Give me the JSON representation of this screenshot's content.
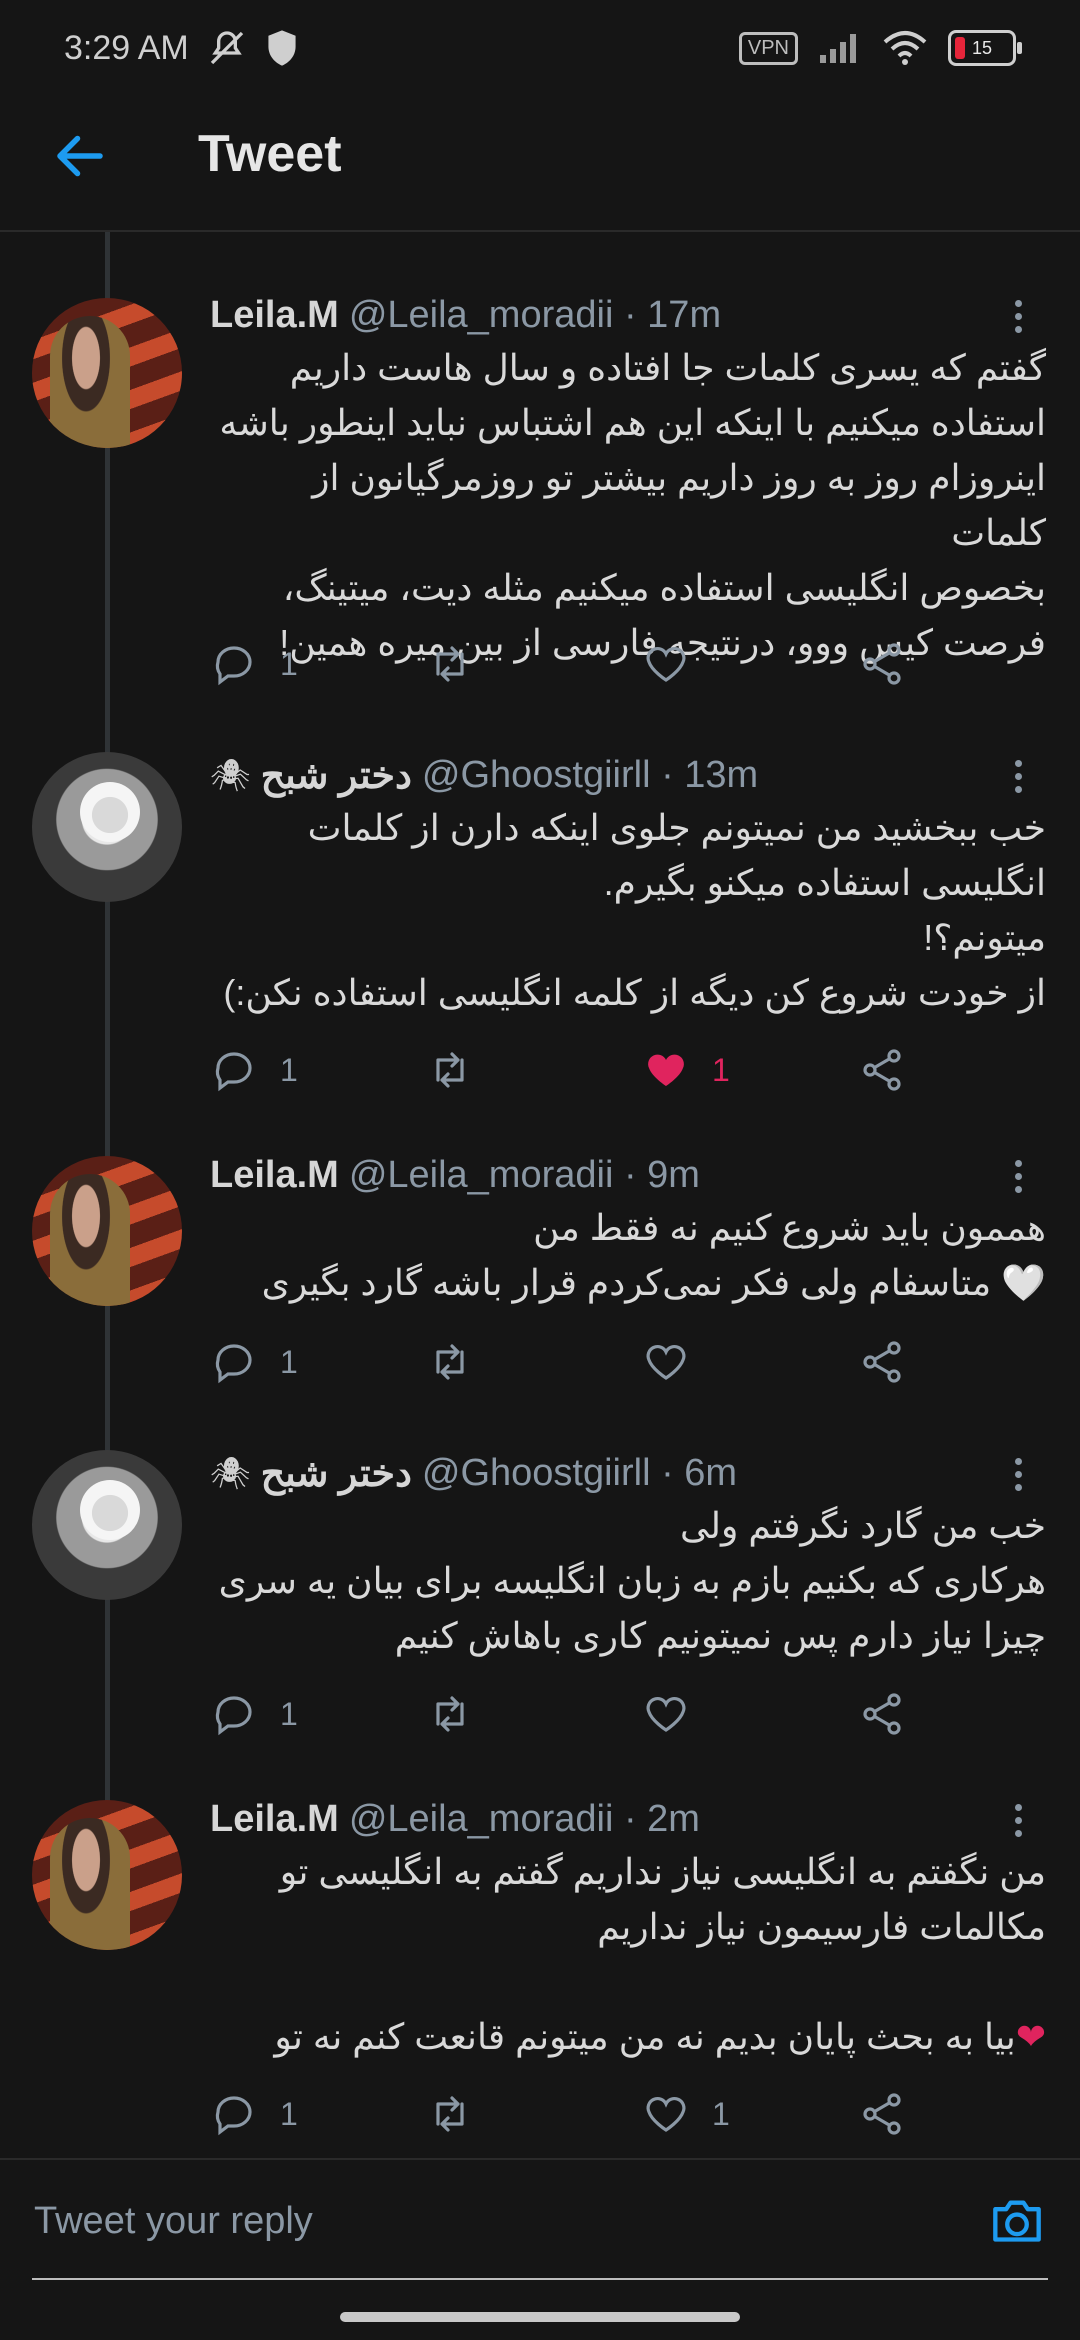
{
  "status": {
    "time": "3:29 AM",
    "vpn": "VPN",
    "battery": "15"
  },
  "header": {
    "title": "Tweet"
  },
  "tweets": [
    {
      "name": "Leila.M",
      "handle": "@Leila_moradii · 17m",
      "lines": [
        "گفتم که یسری کلمات جا افتاده و سال هاست داریم",
        "استفاده میکنیم با اینکه این هم اشتباس نباید اینطور باشه",
        "اینروزام روز به روز داریم بیشتر تو روزمرگیانون از کلمات",
        "بخصوص انگلیسی استفاده میکنیم مثله دیت، میتینگ،",
        "فرصت کیس ووو، درنتیجه فارسی از بین میره همین!"
      ],
      "replies": "1",
      "likes": "",
      "liked": false
    },
    {
      "name": "دختر شبح",
      "handle": "@Ghoostgiirll · 13m",
      "lines": [
        "خب ببخشید من نمیتونم جلوی اینکه دارن از کلمات",
        "انگلیسی استفاده میکنو بگیرم.",
        "میتونم؟!",
        "از خودت شروع کن دیگه از کلمه انگلیسی استفاده نکن:)"
      ],
      "replies": "1",
      "likes": "1",
      "liked": true
    },
    {
      "name": "Leila.M",
      "handle": "@Leila_moradii · 9m",
      "lines": [
        "هممون باید شروع کنیم نه فقط من",
        "متاسفام ولی فکر نمی‌کردم قرار باشه گارد بگیری"
      ],
      "replies": "1",
      "likes": "",
      "liked": false
    },
    {
      "name": "دختر شبح",
      "handle": "@Ghoostgiirll · 6m",
      "lines": [
        "خب من گارد نگرفتم ولی",
        "هرکاری که بکنیم بازم به زبان انگلیسه برای بیان یه سری",
        "چیزا نیاز دارم پس نمیتونیم کاری باهاش کنیم"
      ],
      "replies": "1",
      "likes": "",
      "liked": false
    },
    {
      "name": "Leila.M",
      "handle": "@Leila_moradii · 2m",
      "lines": [
        "من نگفتم به انگلیسی نیاز نداریم گفتم به انگلیسی تو",
        "مکالمات فارسیمون نیاز نداریم",
        "",
        "بیا به بحث پایان بدیم نه من میتونم قانعت کنم نه تو"
      ],
      "replies": "1",
      "likes": "1",
      "liked": false
    }
  ],
  "reply": {
    "placeholder": "Tweet your reply"
  },
  "colors": {
    "accent": "#1d9bf0",
    "like": "#e0245e",
    "muted": "#8b98a5"
  }
}
